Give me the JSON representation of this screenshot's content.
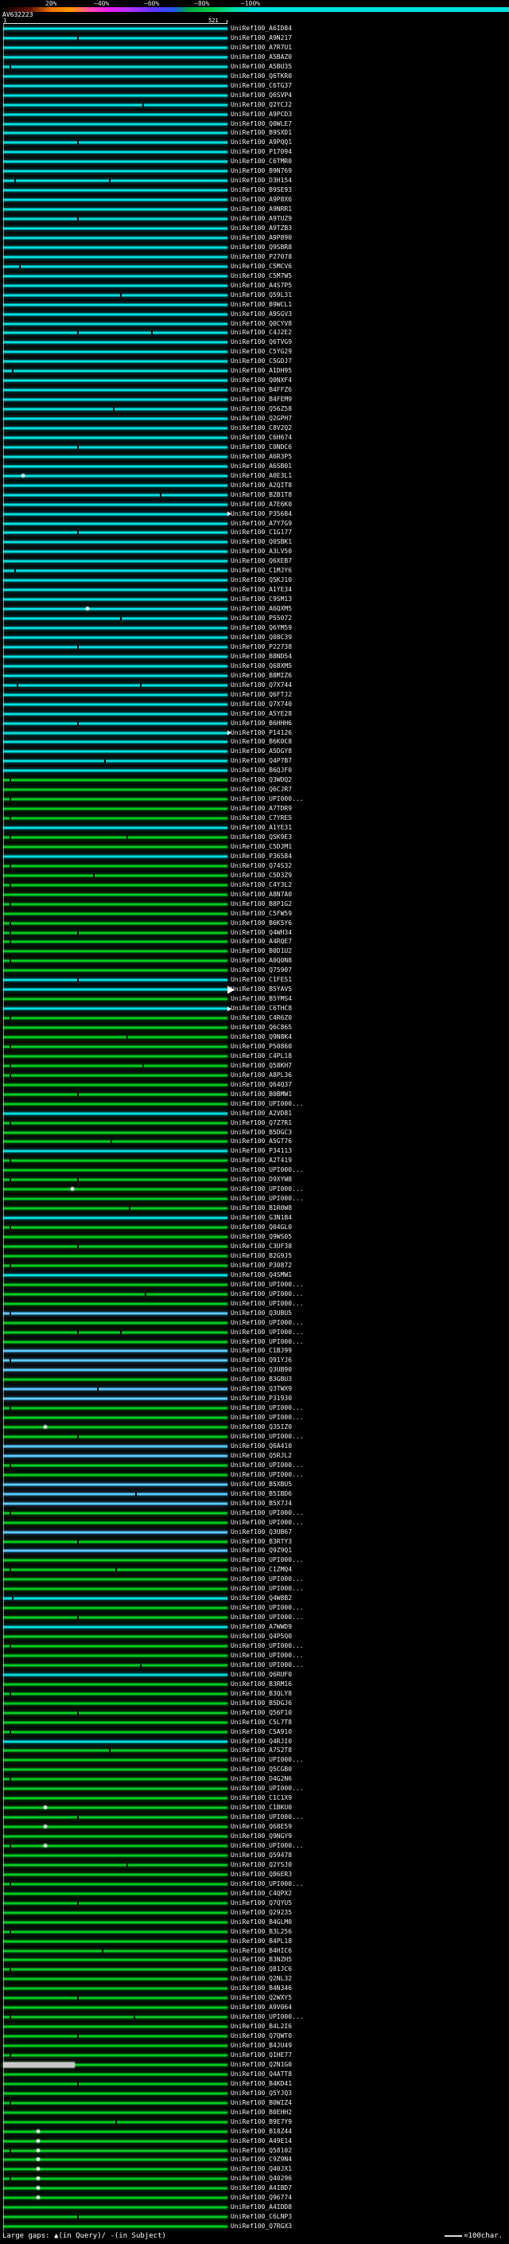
{
  "hit_prefix": "UniRef100_",
  "palette": {
    "c": "#00e0e0",
    "g": "#00cc22",
    "b": "#59c9ff",
    "w": "#c8c8c8"
  },
  "scale": {
    "labels": [
      {
        "text": "20%",
        "x": 57
      },
      {
        "text": "~40%",
        "x": 118
      },
      {
        "text": "~60%",
        "x": 181
      },
      {
        "text": "~80%",
        "x": 244
      },
      {
        "text": "~100%",
        "x": 303
      }
    ],
    "gradient": [
      [
        "#000000",
        0
      ],
      [
        "#661100",
        6
      ],
      [
        "#ee7700",
        10
      ],
      [
        "#ff9900",
        14
      ],
      [
        "#ff44bb",
        18
      ],
      [
        "#ee22ee",
        21
      ],
      [
        "#aa33ff",
        26
      ],
      [
        "#6633ff",
        30
      ],
      [
        "#2255ee",
        34
      ],
      [
        "#00aa44",
        37
      ],
      [
        "#00cc44",
        41
      ],
      [
        "#00ddaa",
        46
      ],
      [
        "#00e0e0",
        50
      ],
      [
        "#00e0e0",
        100
      ]
    ]
  },
  "query": {
    "name": "AV632223",
    "start": "1",
    "end": "521"
  },
  "legend": {
    "gaps": "Large gaps: ▲(in Query)/ -(in Subject)",
    "unit": "=100char."
  },
  "chart_data": {
    "type": "bar",
    "title": "AV632223",
    "x_range": [
      1,
      521
    ],
    "identity_scale_labels": [
      "20%",
      "~40%",
      "~60%",
      "~80%",
      "~100%"
    ],
    "hits": [
      {
        "l": "A6ID84",
        "c": "c"
      },
      {
        "l": "A9N217",
        "c": "c",
        "t": [
          0.33
        ]
      },
      {
        "l": "A7R7U1",
        "c": "c"
      },
      {
        "l": "A5BAZ0",
        "c": "c"
      },
      {
        "l": "A5BU35",
        "c": "c",
        "t": [
          0.03
        ]
      },
      {
        "l": "Q6TKR0",
        "c": "c"
      },
      {
        "l": "C6TG37",
        "c": "c"
      },
      {
        "l": "Q6SVP4",
        "c": "c"
      },
      {
        "l": "Q2YCJ2",
        "c": "c",
        "t": [
          0.62
        ]
      },
      {
        "l": "A9PCD3",
        "c": "c"
      },
      {
        "l": "Q0WLE7",
        "c": "c"
      },
      {
        "l": "B9SXD1",
        "c": "c"
      },
      {
        "l": "A9PQQ1",
        "c": "c",
        "t": [
          0.33
        ]
      },
      {
        "l": "P17094",
        "c": "c"
      },
      {
        "l": "C6TMR0",
        "c": "c"
      },
      {
        "l": "B9N769",
        "c": "c"
      },
      {
        "l": "D3H154",
        "c": "c",
        "t": [
          0.05,
          0.47
        ]
      },
      {
        "l": "B9SE93",
        "c": "c"
      },
      {
        "l": "A9P8X6",
        "c": "c"
      },
      {
        "l": "A9NRR1",
        "c": "c"
      },
      {
        "l": "A9TUZ9",
        "c": "c",
        "t": [
          0.33
        ]
      },
      {
        "l": "A9TZB3",
        "c": "c"
      },
      {
        "l": "A9P890",
        "c": "c"
      },
      {
        "l": "Q9SBR8",
        "c": "c"
      },
      {
        "l": "P27078",
        "c": "c"
      },
      {
        "l": "C5MCV6",
        "c": "c",
        "t": [
          0.07
        ]
      },
      {
        "l": "C5M7W5",
        "c": "c"
      },
      {
        "l": "A4S7P5",
        "c": "c"
      },
      {
        "l": "Q59L31",
        "c": "c",
        "t": [
          0.52
        ]
      },
      {
        "l": "B9WCL1",
        "c": "c"
      },
      {
        "l": "A9SGV3",
        "c": "c"
      },
      {
        "l": "Q0CYV8",
        "c": "c"
      },
      {
        "l": "C4J2E2",
        "c": "c",
        "t": [
          0.33,
          0.66
        ]
      },
      {
        "l": "Q6TVG9",
        "c": "c"
      },
      {
        "l": "C5YG29",
        "c": "c"
      },
      {
        "l": "C5GDJ7",
        "c": "c"
      },
      {
        "l": "A1DH95",
        "c": "c",
        "t": [
          0.04
        ]
      },
      {
        "l": "Q0NXF4",
        "c": "c"
      },
      {
        "l": "B4FFZ6",
        "c": "c"
      },
      {
        "l": "B4FEM9",
        "c": "c"
      },
      {
        "l": "Q56Z58",
        "c": "c",
        "t": [
          0.49
        ]
      },
      {
        "l": "Q2GPH7",
        "c": "c"
      },
      {
        "l": "C8V2Q2",
        "c": "c"
      },
      {
        "l": "C6H674",
        "c": "c"
      },
      {
        "l": "C0NDC6",
        "c": "c",
        "t": [
          0.33
        ]
      },
      {
        "l": "A6R3P5",
        "c": "c"
      },
      {
        "l": "A6SB01",
        "c": "c"
      },
      {
        "l": "A0E3L1",
        "c": "c",
        "d": [
          0.08
        ]
      },
      {
        "l": "A2QIT8",
        "c": "c"
      },
      {
        "l": "B2B1T8",
        "c": "c",
        "t": [
          0.7
        ]
      },
      {
        "l": "A7E6K0",
        "c": "c"
      },
      {
        "l": "P35684",
        "c": "c",
        "a": 1
      },
      {
        "l": "A7Y7G9",
        "c": "c"
      },
      {
        "l": "C1G177",
        "c": "c",
        "t": [
          0.33
        ]
      },
      {
        "l": "Q0SBK1",
        "c": "c"
      },
      {
        "l": "A3LV50",
        "c": "c"
      },
      {
        "l": "Q6XEB7",
        "c": "c"
      },
      {
        "l": "C1MJY6",
        "c": "c",
        "t": [
          0.05
        ]
      },
      {
        "l": "Q5KJ10",
        "c": "c"
      },
      {
        "l": "A1YE34",
        "c": "c"
      },
      {
        "l": "C9SM13",
        "c": "c"
      },
      {
        "l": "A6QXM5",
        "c": "c",
        "d": [
          0.37
        ]
      },
      {
        "l": "P55072",
        "c": "c",
        "t": [
          0.52
        ]
      },
      {
        "l": "Q6YM59",
        "c": "c"
      },
      {
        "l": "Q08C39",
        "c": "c"
      },
      {
        "l": "P22738",
        "c": "c",
        "t": [
          0.33
        ]
      },
      {
        "l": "B8ND54",
        "c": "c"
      },
      {
        "l": "Q68XM5",
        "c": "c"
      },
      {
        "l": "B8MIZ6",
        "c": "c"
      },
      {
        "l": "Q7X744",
        "c": "c",
        "t": [
          0.06,
          0.61
        ]
      },
      {
        "l": "Q6FTJ2",
        "c": "c"
      },
      {
        "l": "Q7X740",
        "c": "c"
      },
      {
        "l": "A5YE28",
        "c": "c"
      },
      {
        "l": "B6HHH6",
        "c": "c",
        "t": [
          0.33
        ]
      },
      {
        "l": "P14126",
        "c": "c",
        "a": 1
      },
      {
        "l": "B6K0C8",
        "c": "c"
      },
      {
        "l": "A5DGY8",
        "c": "c"
      },
      {
        "l": "Q4P7B7",
        "c": "c",
        "t": [
          0.45
        ]
      },
      {
        "l": "B6QJF0",
        "c": "c"
      },
      {
        "l": "Q3WDQ2",
        "c": "g",
        "t": [
          0.03
        ]
      },
      {
        "l": "Q6CJR7",
        "c": "g"
      },
      {
        "l": "UPI000...",
        "c": "g",
        "t": [
          0.03
        ]
      },
      {
        "l": "A7TDR9",
        "c": "g"
      },
      {
        "l": "C7YRE5",
        "c": "g",
        "t": [
          0.03
        ]
      },
      {
        "l": "A1YE31",
        "c": "c"
      },
      {
        "l": "Q5K9E3",
        "c": "g",
        "t": [
          0.03,
          0.55
        ]
      },
      {
        "l": "C5DJM1",
        "c": "g"
      },
      {
        "l": "P36584",
        "c": "c"
      },
      {
        "l": "Q74S32",
        "c": "g",
        "t": [
          0.03
        ]
      },
      {
        "l": "C5D3Z9",
        "c": "g",
        "t": [
          0.4
        ]
      },
      {
        "l": "C4Y3L2",
        "c": "g",
        "t": [
          0.03
        ]
      },
      {
        "l": "A8N7A0",
        "c": "g"
      },
      {
        "l": "B8P1G2",
        "c": "g",
        "t": [
          0.03
        ]
      },
      {
        "l": "C5FW59",
        "c": "g"
      },
      {
        "l": "B6K5Y6",
        "c": "g",
        "t": [
          0.03
        ]
      },
      {
        "l": "Q4WH34",
        "c": "g",
        "t": [
          0.03,
          0.33
        ]
      },
      {
        "l": "A4RQE7",
        "c": "g",
        "t": [
          0.03
        ]
      },
      {
        "l": "B0D1U2",
        "c": "g"
      },
      {
        "l": "A0Q0N8",
        "c": "g",
        "t": [
          0.03
        ]
      },
      {
        "l": "Q75907",
        "c": "g"
      },
      {
        "l": "C1FES1",
        "c": "c",
        "t": [
          0.33
        ]
      },
      {
        "l": "B5YAV5",
        "c": "c",
        "a": 2
      },
      {
        "l": "B5YMS4",
        "c": "g"
      },
      {
        "l": "C6THC8",
        "c": "c",
        "a": 1
      },
      {
        "l": "C4R6Z0",
        "c": "g",
        "t": [
          0.03
        ]
      },
      {
        "l": "Q6C865",
        "c": "g"
      },
      {
        "l": "Q9N8K4",
        "c": "g",
        "t": [
          0.55
        ]
      },
      {
        "l": "P50860",
        "c": "g",
        "t": [
          0.03
        ]
      },
      {
        "l": "C4PL18",
        "c": "g"
      },
      {
        "l": "Q58KH7",
        "c": "g",
        "t": [
          0.03,
          0.62
        ]
      },
      {
        "l": "A8PL36",
        "c": "g",
        "t": [
          0.03
        ]
      },
      {
        "l": "Q64Q37",
        "c": "g"
      },
      {
        "l": "B0BMW1",
        "c": "g",
        "t": [
          0.33
        ]
      },
      {
        "l": "UPI000...",
        "c": "g"
      },
      {
        "l": "A2VD81",
        "c": "c"
      },
      {
        "l": "Q7Z7R1",
        "c": "g",
        "t": [
          0.03
        ]
      },
      {
        "l": "B5DGC3",
        "c": "g"
      },
      {
        "l": "A5GT76",
        "c": "g",
        "t": [
          0.48
        ]
      },
      {
        "l": "P34113",
        "c": "c"
      },
      {
        "l": "A2T419",
        "c": "g",
        "t": [
          0.03
        ]
      },
      {
        "l": "UPI000...",
        "c": "g"
      },
      {
        "l": "D9XYW8",
        "c": "g",
        "t": [
          0.03,
          0.33
        ]
      },
      {
        "l": "UPI000...",
        "c": "g",
        "d": [
          0.3
        ]
      },
      {
        "l": "UPI000...",
        "c": "g"
      },
      {
        "l": "B1R0W8",
        "c": "g",
        "t": [
          0.56
        ]
      },
      {
        "l": "G3N1B4",
        "c": "c"
      },
      {
        "l": "Q04GL0",
        "c": "g",
        "t": [
          0.03
        ]
      },
      {
        "l": "Q9WS05",
        "c": "g"
      },
      {
        "l": "C3UF38",
        "c": "g",
        "t": [
          0.33
        ]
      },
      {
        "l": "B2G9J5",
        "c": "g"
      },
      {
        "l": "P30872",
        "c": "g",
        "t": [
          0.03
        ]
      },
      {
        "l": "Q4SMW1",
        "c": "c"
      },
      {
        "l": "UPI000...",
        "c": "g"
      },
      {
        "l": "UPI000...",
        "c": "g",
        "t": [
          0.63
        ]
      },
      {
        "l": "UPI000...",
        "c": "g"
      },
      {
        "l": "Q3UBU5",
        "c": "b",
        "t": [
          0.03
        ]
      },
      {
        "l": "UPI000...",
        "c": "g"
      },
      {
        "l": "UPI000...",
        "c": "g",
        "t": [
          0.33,
          0.52
        ]
      },
      {
        "l": "UPI000...",
        "c": "g"
      },
      {
        "l": "C1BJ99",
        "c": "b"
      },
      {
        "l": "Q91YJ6",
        "c": "b",
        "t": [
          0.03
        ]
      },
      {
        "l": "Q3UB90",
        "c": "b"
      },
      {
        "l": "B3GBU3",
        "c": "g"
      },
      {
        "l": "Q3TWX9",
        "c": "b",
        "t": [
          0.42
        ]
      },
      {
        "l": "P31930",
        "c": "b"
      },
      {
        "l": "UPI000...",
        "c": "g",
        "t": [
          0.03
        ]
      },
      {
        "l": "UPI000...",
        "c": "g"
      },
      {
        "l": "Q35IZ0",
        "c": "g",
        "d": [
          0.18
        ]
      },
      {
        "l": "UPI000...",
        "c": "g",
        "t": [
          0.33
        ]
      },
      {
        "l": "Q6A410",
        "c": "b"
      },
      {
        "l": "Q5RJL2",
        "c": "b"
      },
      {
        "l": "UPI000...",
        "c": "g",
        "t": [
          0.03
        ]
      },
      {
        "l": "UPI000...",
        "c": "g"
      },
      {
        "l": "B5XBU5",
        "c": "b"
      },
      {
        "l": "B5IBD6",
        "c": "b",
        "t": [
          0.59
        ]
      },
      {
        "l": "B5X7J4",
        "c": "b"
      },
      {
        "l": "UPI000...",
        "c": "g",
        "t": [
          0.03
        ]
      },
      {
        "l": "UPI000...",
        "c": "g"
      },
      {
        "l": "Q3UB67",
        "c": "b"
      },
      {
        "l": "B3RTY3",
        "c": "g",
        "t": [
          0.33
        ]
      },
      {
        "l": "Q9Z9Q1",
        "c": "b"
      },
      {
        "l": "UPI000...",
        "c": "g"
      },
      {
        "l": "C1ZMQ4",
        "c": "g",
        "t": [
          0.03,
          0.5
        ]
      },
      {
        "l": "UPI000...",
        "c": "g"
      },
      {
        "l": "UPI000...",
        "c": "g"
      },
      {
        "l": "Q4W8B2",
        "c": "c",
        "t": [
          0.04
        ]
      },
      {
        "l": "UPI000...",
        "c": "g"
      },
      {
        "l": "UPI000...",
        "c": "g",
        "t": [
          0.33
        ]
      },
      {
        "l": "A7WWD9",
        "c": "c"
      },
      {
        "l": "Q4P5Q0",
        "c": "g"
      },
      {
        "l": "UPI000...",
        "c": "g",
        "t": [
          0.03
        ]
      },
      {
        "l": "UPI000...",
        "c": "g"
      },
      {
        "l": "UPI000...",
        "c": "g",
        "t": [
          0.61
        ]
      },
      {
        "l": "Q6RUF0",
        "c": "c"
      },
      {
        "l": "B3RM16",
        "c": "g"
      },
      {
        "l": "B3QLY8",
        "c": "g",
        "t": [
          0.03
        ]
      },
      {
        "l": "B5DGJ6",
        "c": "g"
      },
      {
        "l": "Q56F10",
        "c": "g",
        "t": [
          0.33
        ]
      },
      {
        "l": "C5L7T8",
        "c": "g"
      },
      {
        "l": "C5A910",
        "c": "g",
        "t": [
          0.03
        ]
      },
      {
        "l": "Q4RJI0",
        "c": "c"
      },
      {
        "l": "A7S2T8",
        "c": "g",
        "t": [
          0.47
        ]
      },
      {
        "l": "UPI000...",
        "c": "g"
      },
      {
        "l": "Q5CGB0",
        "c": "g"
      },
      {
        "l": "D4G2N6",
        "c": "g",
        "t": [
          0.03
        ]
      },
      {
        "l": "UPI000...",
        "c": "g"
      },
      {
        "l": "C1C1X9",
        "c": "g"
      },
      {
        "l": "C1BKU0",
        "c": "g",
        "d": [
          0.18
        ]
      },
      {
        "l": "UPI000...",
        "c": "g",
        "t": [
          0.33
        ]
      },
      {
        "l": "Q68E59",
        "c": "g",
        "d": [
          0.18
        ]
      },
      {
        "l": "Q9NGY9",
        "c": "g"
      },
      {
        "l": "UPI000...",
        "c": "g",
        "t": [
          0.03
        ],
        "d": [
          0.18
        ]
      },
      {
        "l": "Q59478",
        "c": "g"
      },
      {
        "l": "Q2YSJ0",
        "c": "g",
        "t": [
          0.55
        ]
      },
      {
        "l": "Q86ER3",
        "c": "g"
      },
      {
        "l": "UPI000...",
        "c": "g",
        "t": [
          0.03
        ]
      },
      {
        "l": "C4QPX2",
        "c": "g"
      },
      {
        "l": "Q7QYU5",
        "c": "g",
        "t": [
          0.33
        ]
      },
      {
        "l": "Q29235",
        "c": "g"
      },
      {
        "l": "B4GLM0",
        "c": "g"
      },
      {
        "l": "B3L256",
        "c": "g",
        "t": [
          0.03
        ]
      },
      {
        "l": "B4PL18",
        "c": "g"
      },
      {
        "l": "B4HIC6",
        "c": "g",
        "t": [
          0.44
        ]
      },
      {
        "l": "B3NZH5",
        "c": "g"
      },
      {
        "l": "Q81JC6",
        "c": "g",
        "t": [
          0.03
        ]
      },
      {
        "l": "Q2NL32",
        "c": "g"
      },
      {
        "l": "B4N346",
        "c": "g"
      },
      {
        "l": "Q2WXY5",
        "c": "g",
        "t": [
          0.33
        ]
      },
      {
        "l": "A9V064",
        "c": "g"
      },
      {
        "l": "UPI000...",
        "c": "g",
        "t": [
          0.03,
          0.58
        ]
      },
      {
        "l": "B4L2I6",
        "c": "g"
      },
      {
        "l": "Q7QWT0",
        "c": "g",
        "t": [
          0.33
        ]
      },
      {
        "l": "B4JU49",
        "c": "g"
      },
      {
        "l": "Q1HE77",
        "c": "g",
        "t": [
          0.03
        ]
      },
      {
        "l": "Q2N1G0",
        "c": "g",
        "s": [
          [
            0,
            0.32,
            "w"
          ]
        ]
      },
      {
        "l": "Q4ATT8",
        "c": "g"
      },
      {
        "l": "B4KD41",
        "c": "g",
        "t": [
          0.33
        ]
      },
      {
        "l": "Q5YJQ3",
        "c": "g"
      },
      {
        "l": "B0WIZ4",
        "c": "g",
        "t": [
          0.03
        ]
      },
      {
        "l": "B0EHH2",
        "c": "g"
      },
      {
        "l": "B9E7Y9",
        "c": "g",
        "t": [
          0.5
        ]
      },
      {
        "l": "B18Z44",
        "c": "g",
        "d": [
          0.15
        ]
      },
      {
        "l": "A49E14",
        "c": "g",
        "d": [
          0.15
        ]
      },
      {
        "l": "Q58102",
        "c": "g",
        "d": [
          0.15
        ],
        "t": [
          0.03
        ]
      },
      {
        "l": "C9Z9N4",
        "c": "g",
        "d": [
          0.15
        ]
      },
      {
        "l": "Q40JX1",
        "c": "g",
        "d": [
          0.15
        ]
      },
      {
        "l": "Q40296",
        "c": "g",
        "d": [
          0.15
        ],
        "t": [
          0.03
        ]
      },
      {
        "l": "A4IBD7",
        "c": "g",
        "d": [
          0.15
        ]
      },
      {
        "l": "Q96774",
        "c": "g",
        "d": [
          0.15
        ]
      },
      {
        "l": "A4IDD8",
        "c": "g"
      },
      {
        "l": "C6LNP3",
        "c": "g",
        "t": [
          0.33
        ]
      },
      {
        "l": "Q7RGX3",
        "c": "g"
      }
    ]
  }
}
